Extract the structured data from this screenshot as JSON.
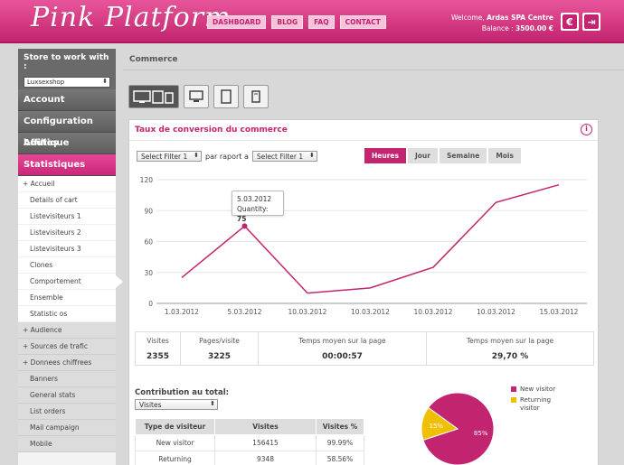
{
  "header": {
    "logo": "Pink Platform",
    "nav": [
      "DASHBOARD",
      "BLOG",
      "FAQ",
      "CONTACT"
    ],
    "welcome_prefix": "Welcome,",
    "user": "Ardas SPA Centre",
    "balance_label": "Balance :",
    "balance": "3500.00 €",
    "currency_button": "€",
    "logout_button": "⇥"
  },
  "sidebar": {
    "store_title": "Store to work with :",
    "store_value": "Luxsexshop",
    "sections": [
      "Account",
      "Configuration boutique",
      "Affilies",
      "Statistiques"
    ],
    "stat_items": [
      "Accueil",
      "Details of cart",
      "Listevisiteurs 1",
      "Listevisiteurs 2",
      "Listevisiteurs 3",
      "Clones",
      "Comportement",
      "Ensemble",
      "Statistic os"
    ],
    "group_items": [
      "Audience",
      "Sources de trafic",
      "Donnees chiffrees"
    ],
    "grey_items": [
      "Banners",
      "General stats",
      "List orders",
      "Mail campaign",
      "Mobile"
    ]
  },
  "main": {
    "breadcrumb": "Commerce",
    "panel_title": "Taux de conversion du commerce",
    "filter1": "Select Filter 1",
    "filter_between": "par raport a",
    "filter2": "Select Filter 1",
    "tabs": [
      "Heures",
      "Jour",
      "Semaine",
      "Mois"
    ],
    "tooltip": {
      "date": "5.03.2012",
      "label": "Quantity:",
      "value": "75"
    },
    "stats": [
      {
        "label": "Visites",
        "value": "2355"
      },
      {
        "label": "Pages/visite",
        "value": "3225"
      },
      {
        "label": "Temps moyen sur la page",
        "value": "00:00:57"
      },
      {
        "label": "Temps moyen sur la page",
        "value": "29,70 %"
      }
    ],
    "contribution_title": "Contribution au total:",
    "contribution_select": "Visites",
    "table": {
      "headers": [
        "Type de visiteur",
        "Visites",
        "Visites %"
      ],
      "rows": [
        [
          "New visitor",
          "156415",
          "99.99%"
        ],
        [
          "Returning",
          "9348",
          "58.56%"
        ]
      ]
    },
    "legend": [
      "New visitor",
      "Returning visitor"
    ]
  },
  "colors": {
    "accent": "#c3246f",
    "returning": "#f0c000"
  },
  "chart_data": [
    {
      "type": "line",
      "x": [
        "1.03.2012",
        "5.03.2012",
        "10.03.2012",
        "10.03.2012",
        "10.03.2012",
        "10.03.2012",
        "15.03.2012"
      ],
      "series": [
        {
          "values": [
            25,
            75,
            10,
            15,
            35,
            98,
            115
          ]
        }
      ],
      "yticks": [
        0,
        30,
        60,
        90,
        120
      ],
      "ylim": [
        0,
        120
      ],
      "grid": true
    },
    {
      "type": "pie",
      "labels": [
        "New visitor",
        "Returning visitor"
      ],
      "values": [
        85,
        15
      ],
      "slice_labels": [
        "85%",
        "15%"
      ]
    }
  ]
}
